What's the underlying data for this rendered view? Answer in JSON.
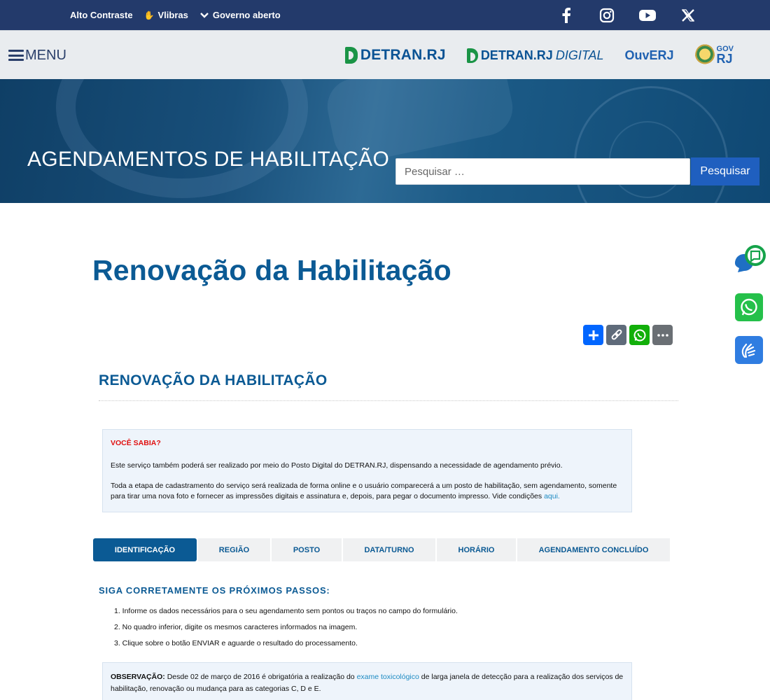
{
  "topbar": {
    "high_contrast": "Alto Contraste",
    "vlibras": "Vlibras",
    "gov_open": "Governo aberto",
    "socials": [
      "facebook-icon",
      "instagram-icon",
      "youtube-icon",
      "x-icon"
    ]
  },
  "header": {
    "menu_label": "MENU",
    "logo_detran": "DETRAN.RJ",
    "logo_digital_bold": "DETRAN.RJ",
    "logo_digital_italic": "DIGITAL",
    "logo_ouv": "OuvERJ",
    "logo_gov_top": "GOV",
    "logo_gov_bottom": "RJ"
  },
  "banner": {
    "title": "AGENDAMENTOS DE HABILITAÇÃO",
    "search_placeholder": "Pesquisar …",
    "search_button": "Pesquisar"
  },
  "main": {
    "page_title": "Renovação da Habilitação",
    "section_title": "RENOVAÇÃO DA HABILITAÇÃO",
    "info": {
      "kicker": "VOCÊ SABIA?",
      "p1": "Este serviço também poderá ser realizado por meio do Posto Digital do DETRAN.RJ, dispensando a necessidade de agendamento prévio.",
      "p2": "Toda a etapa de cadastramento do serviço será realizada de forma online e o usuário comparecerá a um posto de habilitação, sem agendamento, somente para tirar uma nova foto e fornecer as impressões digitais e assinatura e, depois, para pegar o documento impresso. Vide condições",
      "p2_link": "aqui."
    },
    "tabs": [
      {
        "label": "IDENTIFICAÇÃO",
        "width": 148
      },
      {
        "label": "REGIÃO",
        "width": 103
      },
      {
        "label": "POSTO",
        "width": 100
      },
      {
        "label": "DATA/TURNO",
        "width": 132
      },
      {
        "label": "HORÁRIO",
        "width": 113
      },
      {
        "label": "AGENDAMENTO CONCLUÍDO",
        "width": 218
      }
    ],
    "steps_title": "SIGA CORRETAMENTE OS PRÓXIMOS PASSOS:",
    "steps": [
      "1. Informe os dados necessários para o seu agendamento sem pontos ou traços no campo do formulário.",
      "2. No quadro inferior, digite os mesmos caracteres informados na imagem.",
      "3. Clique sobre o botão ENVIAR e aguarde o resultado do processamento."
    ],
    "obs": {
      "label": "OBSERVAÇÃO:",
      "text_before": " Desde 02 de março de 2016 é obrigatória a realização do ",
      "link": "exame toxicológico",
      "text_after": " de larga janela de detecção para a realização dos serviços de habilitação, renovação ou mudança para as categorias C, D e E."
    }
  },
  "colors": {
    "topbar_bg": "#233a6b",
    "brand_blue": "#0b5a94",
    "search_button": "#1f5fbf",
    "alert_red": "#e01010"
  }
}
